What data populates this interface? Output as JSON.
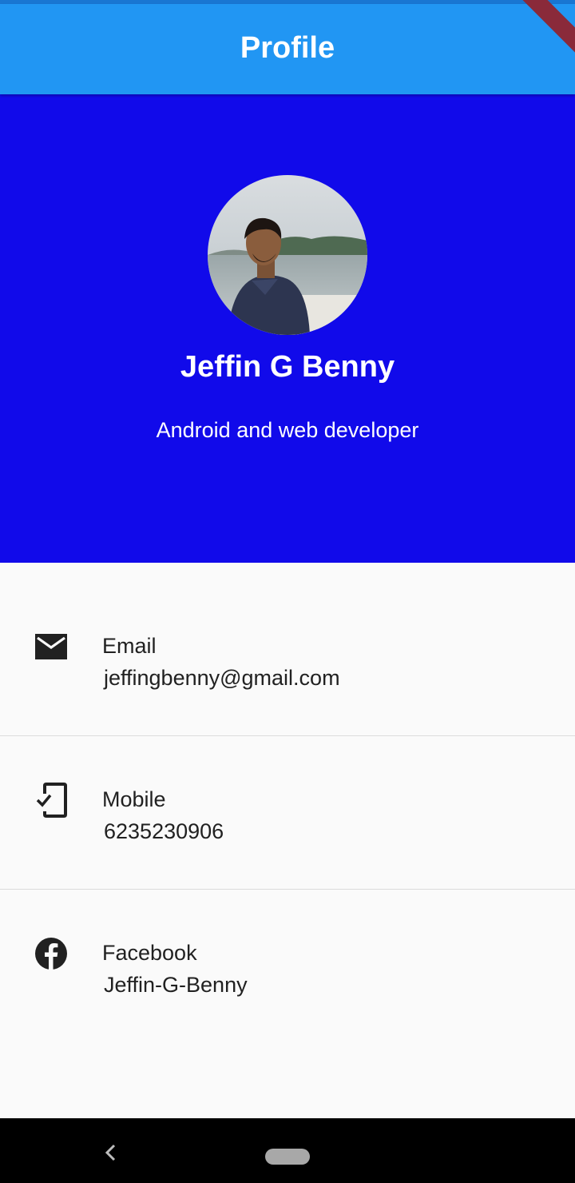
{
  "app_bar": {
    "title": "Profile"
  },
  "profile": {
    "name": "Jeffin G Benny",
    "tagline": "Android and web developer"
  },
  "contacts": [
    {
      "label": "Email",
      "value": "jeffingbenny@gmail.com",
      "icon": "email-icon"
    },
    {
      "label": "Mobile",
      "value": "6235230906",
      "icon": "phone-check-icon"
    },
    {
      "label": "Facebook",
      "value": "Jeffin-G-Benny",
      "icon": "facebook-icon"
    }
  ],
  "colors": {
    "app_bar": "#2196f3",
    "header": "#110aea",
    "background": "#fafafa",
    "text": "#212121"
  }
}
